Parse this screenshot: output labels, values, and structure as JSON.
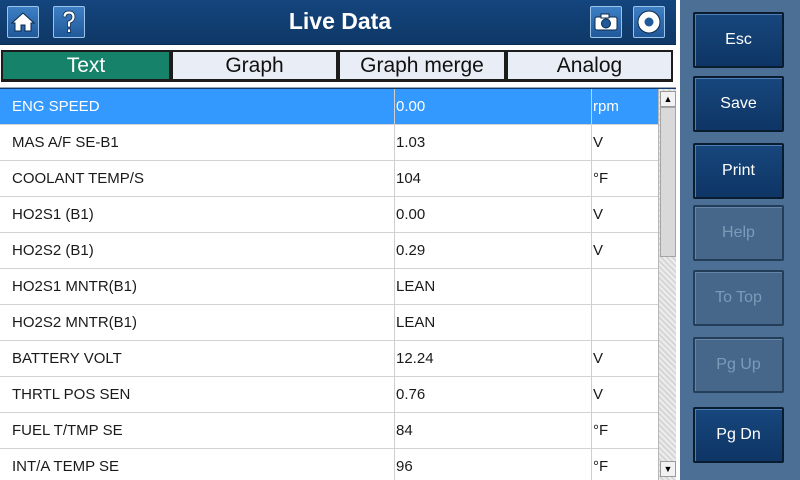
{
  "header": {
    "title": "Live Data",
    "home_icon": "home-icon",
    "help_icon": "help-icon",
    "camera_icon": "camera-icon",
    "record_icon": "record-icon"
  },
  "tabs": [
    {
      "label": "Text",
      "active": true
    },
    {
      "label": "Graph",
      "active": false
    },
    {
      "label": "Graph merge",
      "active": false
    },
    {
      "label": "Analog",
      "active": false
    }
  ],
  "rows": [
    {
      "name": "ENG SPEED",
      "value": "0.00",
      "unit": "rpm",
      "selected": true
    },
    {
      "name": "MAS A/F SE-B1",
      "value": "1.03",
      "unit": "V"
    },
    {
      "name": "COOLANT TEMP/S",
      "value": "104",
      "unit": "°F"
    },
    {
      "name": "HO2S1 (B1)",
      "value": "0.00",
      "unit": "V"
    },
    {
      "name": "HO2S2 (B1)",
      "value": "0.29",
      "unit": "V"
    },
    {
      "name": "HO2S1 MNTR(B1)",
      "value": "LEAN",
      "unit": ""
    },
    {
      "name": "HO2S2 MNTR(B1)",
      "value": "LEAN",
      "unit": ""
    },
    {
      "name": "BATTERY VOLT",
      "value": "12.24",
      "unit": "V"
    },
    {
      "name": "THRTL POS SEN",
      "value": "0.76",
      "unit": "V"
    },
    {
      "name": "FUEL T/TMP SE",
      "value": "84",
      "unit": "°F"
    },
    {
      "name": "INT/A TEMP SE",
      "value": "96",
      "unit": "°F"
    }
  ],
  "side_buttons": [
    {
      "label": "Esc",
      "enabled": true
    },
    {
      "label": "Save",
      "enabled": true
    },
    {
      "label": "Print",
      "enabled": true
    },
    {
      "label": "Help",
      "enabled": false
    },
    {
      "label": "To Top",
      "enabled": false
    },
    {
      "label": "Pg Up",
      "enabled": false
    },
    {
      "label": "Pg Dn",
      "enabled": true
    }
  ],
  "colors": {
    "header": "#14457e",
    "active_tab": "#168269",
    "selected_row": "#3399ff",
    "side_panel": "#4b6f95"
  }
}
